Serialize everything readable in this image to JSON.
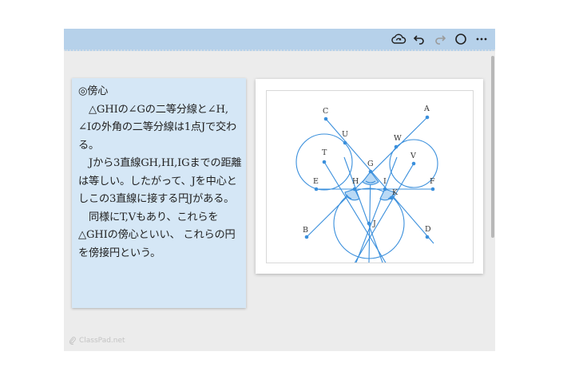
{
  "toolbar": {
    "icons": [
      "cloud-sync-icon",
      "undo-icon",
      "redo-icon",
      "circle-icon",
      "more-icon"
    ]
  },
  "note": {
    "paragraphs": [
      "◎傍心",
      "　△GHIの∠Gの二等分線と∠H, ∠Iの外角の二等分線は1点Jで交わる。",
      "　Jから3直線GH,HI,IGまでの距離は等しい。したがって、Jを中心としこの3直線に接する円Jがある。",
      "　同様にT,Vもあり、これらを△GHIの傍心といい、 これらの円を傍接円という。"
    ]
  },
  "figure": {
    "labels": [
      "A",
      "B",
      "C",
      "D",
      "E",
      "F",
      "G",
      "H",
      "I",
      "J",
      "K",
      "T",
      "U",
      "V",
      "W"
    ],
    "line_color": "#3a8fdc",
    "fill_color": "#b9d9f5"
  },
  "brand": {
    "text": "ClassPad.net"
  }
}
